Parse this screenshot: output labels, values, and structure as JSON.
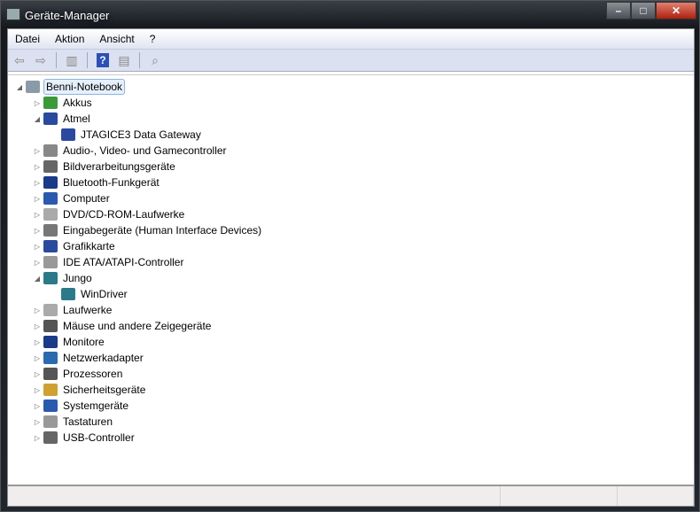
{
  "window": {
    "title": "Geräte-Manager"
  },
  "controls": {
    "minimize": "–",
    "maximize": "□",
    "close": "✕"
  },
  "menu": [
    "Datei",
    "Aktion",
    "Ansicht",
    "?"
  ],
  "toolbar": [
    {
      "icon": "back-arrow-icon",
      "glyph": "⇦"
    },
    {
      "icon": "forward-arrow-icon",
      "glyph": "⇨"
    },
    {
      "icon": "show-hide-console-tree-icon",
      "glyph": "▥"
    },
    {
      "icon": "help-icon",
      "glyph": "?"
    },
    {
      "icon": "properties-pane-icon",
      "glyph": "▤"
    },
    {
      "icon": "scan-hardware-icon",
      "glyph": "⌕"
    }
  ],
  "tree": [
    {
      "label": "Benni-Notebook",
      "level": 0,
      "state": "expanded",
      "color": "#8a9aa8"
    },
    {
      "label": "Akkus",
      "level": 1,
      "state": "collapsed",
      "color": "#3a9a3a"
    },
    {
      "label": "Atmel",
      "level": 1,
      "state": "expanded",
      "color": "#2a4aa0"
    },
    {
      "label": "JTAGICE3 Data Gateway",
      "level": 2,
      "state": "leaf",
      "color": "#2a4aa0"
    },
    {
      "label": "Audio-, Video- und Gamecontroller",
      "level": 1,
      "state": "collapsed",
      "color": "#888"
    },
    {
      "label": "Bildverarbeitungsgeräte",
      "level": 1,
      "state": "collapsed",
      "color": "#666"
    },
    {
      "label": "Bluetooth-Funkgerät",
      "level": 1,
      "state": "collapsed",
      "color": "#1a3a8a"
    },
    {
      "label": "Computer",
      "level": 1,
      "state": "collapsed",
      "color": "#2a5ab0"
    },
    {
      "label": "DVD/CD-ROM-Laufwerke",
      "level": 1,
      "state": "collapsed",
      "color": "#aaa"
    },
    {
      "label": "Eingabegeräte (Human Interface Devices)",
      "level": 1,
      "state": "collapsed",
      "color": "#777"
    },
    {
      "label": "Grafikkarte",
      "level": 1,
      "state": "collapsed",
      "color": "#2a4aa0"
    },
    {
      "label": "IDE ATA/ATAPI-Controller",
      "level": 1,
      "state": "collapsed",
      "color": "#999"
    },
    {
      "label": "Jungo",
      "level": 1,
      "state": "expanded",
      "color": "#2a7a8a"
    },
    {
      "label": "WinDriver",
      "level": 2,
      "state": "leaf",
      "color": "#2a7a8a"
    },
    {
      "label": "Laufwerke",
      "level": 1,
      "state": "collapsed",
      "color": "#aaa"
    },
    {
      "label": "Mäuse und andere Zeigegeräte",
      "level": 1,
      "state": "collapsed",
      "color": "#555"
    },
    {
      "label": "Monitore",
      "level": 1,
      "state": "collapsed",
      "color": "#1a3a8a"
    },
    {
      "label": "Netzwerkadapter",
      "level": 1,
      "state": "collapsed",
      "color": "#2a6ab0"
    },
    {
      "label": "Prozessoren",
      "level": 1,
      "state": "collapsed",
      "color": "#555"
    },
    {
      "label": "Sicherheitsgeräte",
      "level": 1,
      "state": "collapsed",
      "color": "#d0a030"
    },
    {
      "label": "Systemgeräte",
      "level": 1,
      "state": "collapsed",
      "color": "#2a5ab0"
    },
    {
      "label": "Tastaturen",
      "level": 1,
      "state": "collapsed",
      "color": "#999"
    },
    {
      "label": "USB-Controller",
      "level": 1,
      "state": "collapsed",
      "color": "#666"
    }
  ]
}
